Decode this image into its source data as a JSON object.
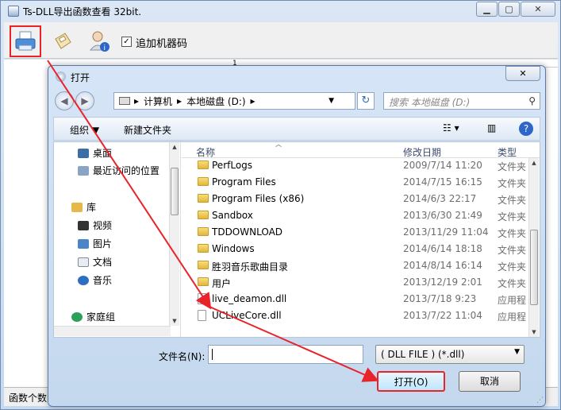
{
  "window": {
    "title": "Ts-DLL导出函数查看 32bit."
  },
  "toolbar": {
    "add_machine_code_label": "追加机器码"
  },
  "grid": {
    "first_column_number": "1"
  },
  "status": {
    "text": "函数个数"
  },
  "dialog": {
    "title": "打开",
    "breadcrumb": [
      "计算机",
      "本地磁盘 (D:)"
    ],
    "search_placeholder": "搜索 本地磁盘 (D:)",
    "command_bar": {
      "organize": "组织 ▼",
      "new_folder": "新建文件夹"
    },
    "navigation": [
      {
        "label": "桌面",
        "icon": "desktop-icon",
        "color": "#3a6ea5"
      },
      {
        "label": "最近访问的位置",
        "icon": "recent-places-icon",
        "color": "#8aa4c4"
      },
      {
        "label": "库",
        "icon": "library-icon",
        "color": "#e5b84a"
      },
      {
        "label": "视频",
        "icon": "video-icon",
        "color": "#333333"
      },
      {
        "label": "图片",
        "icon": "picture-icon",
        "color": "#4a86c7"
      },
      {
        "label": "文档",
        "icon": "document-icon",
        "color": "#e8edf3"
      },
      {
        "label": "音乐",
        "icon": "music-icon",
        "color": "#2f6fc2"
      },
      {
        "label": "家庭组",
        "icon": "homegroup-icon",
        "color": "#2aa05a"
      }
    ],
    "columns": {
      "name": "名称",
      "date": "修改日期",
      "type": "类型"
    },
    "files": [
      {
        "name": "PerfLogs",
        "date": "2009/7/14 11:20",
        "type": "文件夹",
        "kind": "folder"
      },
      {
        "name": "Program Files",
        "date": "2014/7/15 16:15",
        "type": "文件夹",
        "kind": "folder"
      },
      {
        "name": "Program Files (x86)",
        "date": "2014/6/3 22:17",
        "type": "文件夹",
        "kind": "folder"
      },
      {
        "name": "Sandbox",
        "date": "2013/6/30 21:49",
        "type": "文件夹",
        "kind": "folder"
      },
      {
        "name": "TDDOWNLOAD",
        "date": "2013/11/29 11:04",
        "type": "文件夹",
        "kind": "folder"
      },
      {
        "name": "Windows",
        "date": "2014/6/14 18:18",
        "type": "文件夹",
        "kind": "folder"
      },
      {
        "name": "胜羽音乐歌曲目录",
        "date": "2014/8/14 16:14",
        "type": "文件夹",
        "kind": "folder"
      },
      {
        "name": "用户",
        "date": "2013/12/19 2:01",
        "type": "文件夹",
        "kind": "folder"
      },
      {
        "name": "live_deamon.dll",
        "date": "2013/7/18 9:23",
        "type": "应用程",
        "kind": "dll"
      },
      {
        "name": "UCLiveCore.dll",
        "date": "2013/7/22 11:04",
        "type": "应用程",
        "kind": "dll"
      }
    ],
    "filename_label": "文件名(N):",
    "filename_value": "",
    "filetype_selected": "( DLL FILE ) (*.dll)",
    "open_button": "打开(O)",
    "cancel_button": "取消"
  },
  "colors": {
    "highlight": "#e8232a",
    "titlebar": "#c7d9ee",
    "accent": "#2d66c8"
  }
}
